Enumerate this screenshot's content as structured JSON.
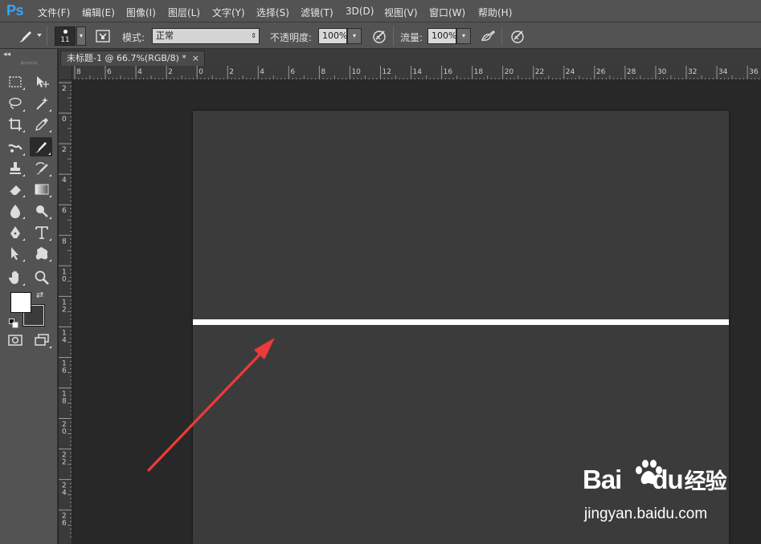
{
  "app": {
    "logo": "Ps",
    "accent_color": "#31a8ff"
  },
  "menubar": {
    "items": [
      "文件(F)",
      "编辑(E)",
      "图像(I)",
      "图层(L)",
      "文字(Y)",
      "选择(S)",
      "滤镜(T)",
      "3D(D)",
      "视图(V)",
      "窗口(W)",
      "帮助(H)"
    ]
  },
  "options": {
    "brush_size": "11",
    "mode_label": "模式:",
    "mode_value": "正常",
    "opacity_label": "不透明度:",
    "opacity_value": "100%",
    "flow_label": "流量:",
    "flow_value": "100%"
  },
  "document": {
    "tab_title": "未标题-1 @ 66.7%(RGB/8) *",
    "close_glyph": "×",
    "canvas_color": "#3c3b3c",
    "stroke_color": "#ffffff"
  },
  "ruler": {
    "top_labels": [
      "8",
      "6",
      "4",
      "2",
      "0",
      "2",
      "4",
      "6",
      "8",
      "10",
      "12",
      "14",
      "16",
      "18",
      "20",
      "22",
      "24",
      "26",
      "28",
      "30",
      "32",
      "34",
      "36"
    ],
    "left_labels": [
      "2",
      "0",
      "2",
      "4",
      "6",
      "8",
      "10",
      "12",
      "14",
      "16",
      "18",
      "20",
      "22",
      "24",
      "26"
    ]
  },
  "tools": {
    "collapse_glyph": "◂◂",
    "swap_glyph": "⇄",
    "foreground_color": "#ffffff",
    "background_color": "#3c3b3c"
  },
  "annotation": {
    "arrow_color": "#ee3a3a"
  },
  "watermark": {
    "logo_bai": "Bai",
    "logo_du": "du",
    "logo_cn": "经验",
    "url": "jingyan.baidu.com"
  }
}
